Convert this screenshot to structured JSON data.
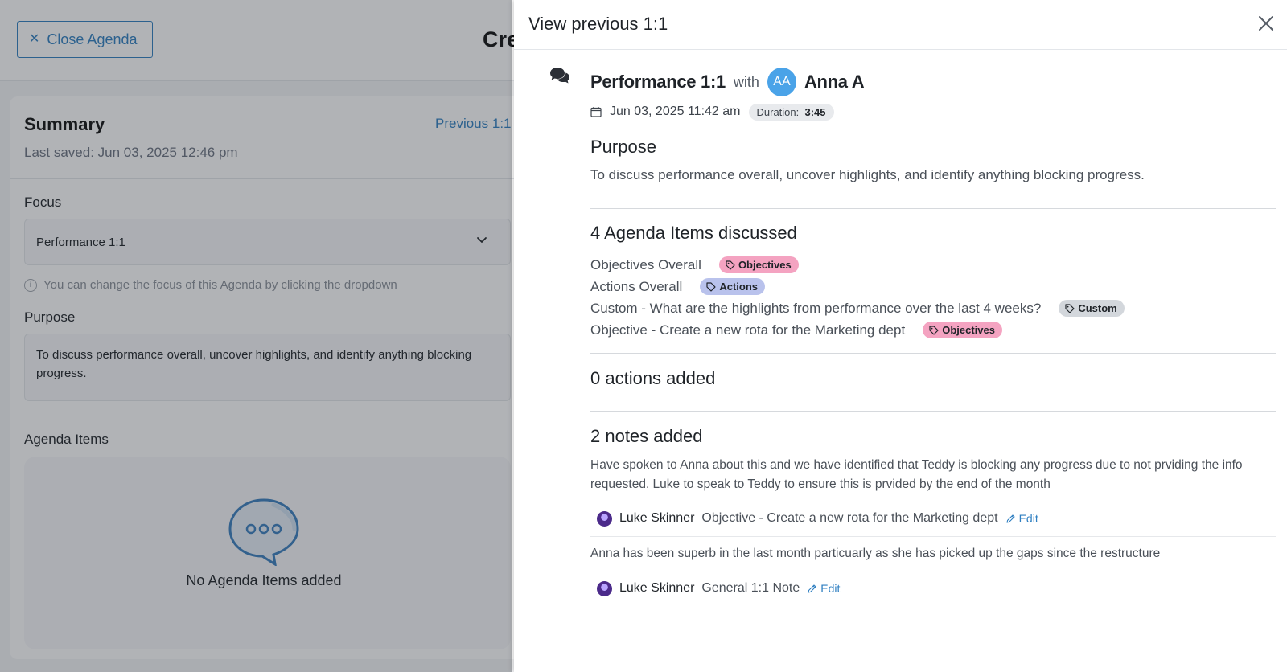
{
  "background": {
    "close_agenda_label": "Close Agenda",
    "page_heading": "Cre",
    "summary": {
      "title": "Summary",
      "last_saved": "Last saved: Jun 03, 2025 12:46 pm",
      "previous_link": "Previous 1:1"
    },
    "focus": {
      "label": "Focus",
      "selected": "Performance 1:1",
      "help": "You can change the focus of this Agenda by clicking the dropdown"
    },
    "purpose": {
      "label": "Purpose",
      "value": "To discuss performance overall, uncover highlights, and identify anything blocking progress."
    },
    "agenda_items": {
      "label": "Agenda Items",
      "empty_text": "No Agenda Items added"
    }
  },
  "panel": {
    "title": "View previous 1:1",
    "meeting": {
      "name": "Performance 1:1",
      "with_label": "with",
      "avatar_initials": "AA",
      "person": "Anna A",
      "date": "Jun 03, 2025 11:42 am",
      "duration_label": "Duration:",
      "duration_value": "3:45"
    },
    "purpose": {
      "heading": "Purpose",
      "text": "To discuss performance overall, uncover highlights, and identify anything blocking progress."
    },
    "agenda": {
      "heading": "4 Agenda Items discussed",
      "items": [
        {
          "label": "Objectives Overall",
          "tag": "Objectives"
        },
        {
          "label": "Actions Overall",
          "tag": "Actions"
        },
        {
          "label": "Custom - What are the highlights from performance over the last 4 weeks?",
          "tag": "Custom"
        },
        {
          "label": "Objective - Create a new rota for the Marketing dept",
          "tag": "Objectives"
        }
      ]
    },
    "actions": {
      "heading": "0 actions added"
    },
    "notes": {
      "heading": "2 notes added",
      "items": [
        {
          "text": "Have spoken to Anna about this and we have identified that Teddy is blocking any progress due to not prviding the info requested. Luke to speak to Teddy to ensure this is prvided by the end of the month",
          "author": "Luke Skinner",
          "context": "Objective - Create a new rota for the Marketing dept",
          "edit_label": "Edit"
        },
        {
          "text": "Anna has been superb in the last month particuarly as she has picked up the gaps since the restructure",
          "author": "Luke Skinner",
          "context": "General 1:1 Note",
          "edit_label": "Edit"
        }
      ]
    }
  },
  "colors": {
    "accent": "#2f7fc1",
    "avatar": "#4aa3e8",
    "tag_objectives": "#f4a3c1",
    "tag_actions": "#b9c2ec",
    "tag_custom": "#d3d7dc"
  },
  "icons": [
    "close-icon",
    "chevron-down-icon",
    "info-icon",
    "chat-bubble-icon",
    "comments-icon",
    "calendar-icon",
    "tag-icon",
    "pencil-icon"
  ]
}
